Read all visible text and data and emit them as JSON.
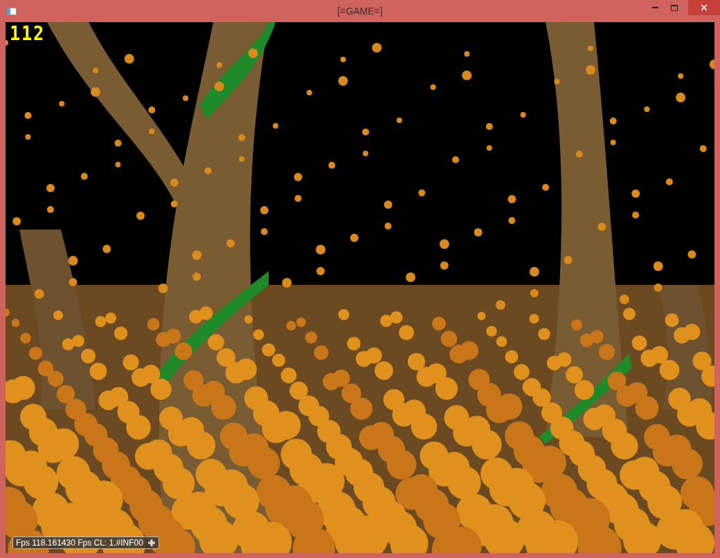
{
  "window": {
    "title": "[=GAME=]"
  },
  "hud": {
    "counter": "112"
  },
  "overlay": {
    "fps_text": "Fps 118.161430 Fps CL: 1.#INF00"
  }
}
